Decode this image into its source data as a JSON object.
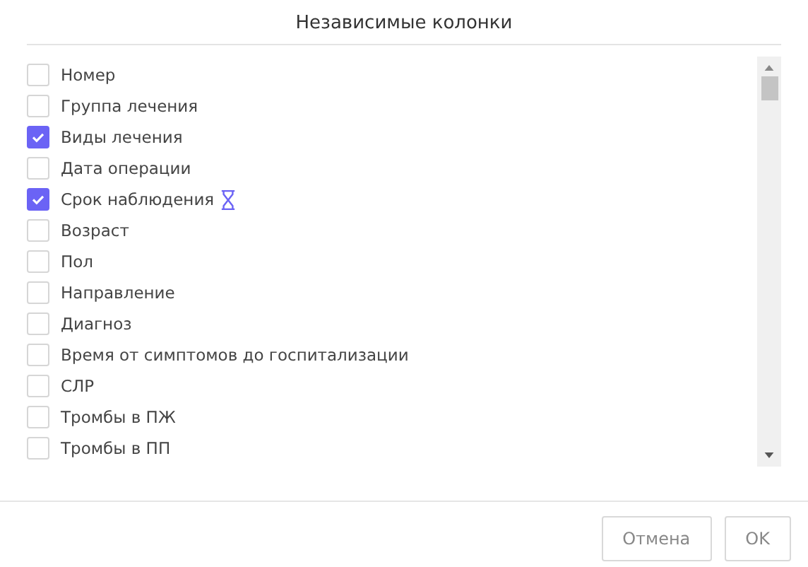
{
  "dialog": {
    "title": "Независимые колонки"
  },
  "columns": [
    {
      "label": "Номер",
      "checked": false,
      "hourglass": false
    },
    {
      "label": "Группа лечения",
      "checked": false,
      "hourglass": false
    },
    {
      "label": "Виды лечения",
      "checked": true,
      "hourglass": false
    },
    {
      "label": "Дата операции",
      "checked": false,
      "hourglass": false
    },
    {
      "label": "Срок наблюдения",
      "checked": true,
      "hourglass": true
    },
    {
      "label": "Возраст",
      "checked": false,
      "hourglass": false
    },
    {
      "label": "Пол",
      "checked": false,
      "hourglass": false
    },
    {
      "label": "Направление",
      "checked": false,
      "hourglass": false
    },
    {
      "label": "Диагноз",
      "checked": false,
      "hourglass": false
    },
    {
      "label": "Время от симптомов до госпитализации",
      "checked": false,
      "hourglass": false
    },
    {
      "label": "СЛР",
      "checked": false,
      "hourglass": false
    },
    {
      "label": "Тромбы в ПЖ",
      "checked": false,
      "hourglass": false
    },
    {
      "label": "Тромбы в ПП",
      "checked": false,
      "hourglass": false
    }
  ],
  "buttons": [
    {
      "label": "Отмена"
    },
    {
      "label": "OK"
    }
  ]
}
